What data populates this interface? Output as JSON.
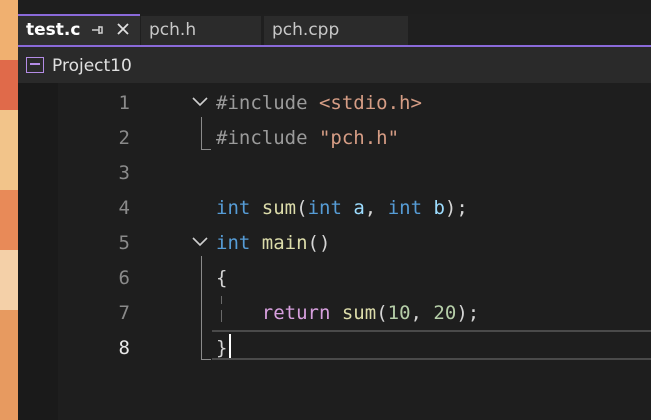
{
  "tabs": [
    {
      "label": "test.c",
      "active": true,
      "pin_icon": "pin-icon",
      "close_icon": "close-icon"
    },
    {
      "label": "pch.h",
      "active": false
    },
    {
      "label": "pch.cpp",
      "active": false
    }
  ],
  "navigation": {
    "project": "Project10",
    "project_icon": "project-icon"
  },
  "editor": {
    "line_numbers": [
      "1",
      "2",
      "3",
      "4",
      "5",
      "6",
      "7",
      "8"
    ],
    "current_line": "8",
    "lines": [
      [
        {
          "t": "#include ",
          "c": "pp"
        },
        {
          "t": "<stdio.h>",
          "c": "str"
        }
      ],
      [
        {
          "t": "#include ",
          "c": "pp"
        },
        {
          "t": "\"pch.h\"",
          "c": "str"
        }
      ],
      [],
      [
        {
          "t": "int",
          "c": "kw"
        },
        {
          "t": " ",
          "c": "punc"
        },
        {
          "t": "sum",
          "c": "fn"
        },
        {
          "t": "(",
          "c": "punc"
        },
        {
          "t": "int",
          "c": "kw"
        },
        {
          "t": " ",
          "c": "punc"
        },
        {
          "t": "a",
          "c": "id"
        },
        {
          "t": ", ",
          "c": "punc"
        },
        {
          "t": "int",
          "c": "kw"
        },
        {
          "t": " ",
          "c": "punc"
        },
        {
          "t": "b",
          "c": "id"
        },
        {
          "t": ");",
          "c": "punc"
        }
      ],
      [
        {
          "t": "int",
          "c": "kw"
        },
        {
          "t": " ",
          "c": "punc"
        },
        {
          "t": "main",
          "c": "fn"
        },
        {
          "t": "()",
          "c": "punc"
        }
      ],
      [
        {
          "t": "{",
          "c": "punc"
        }
      ],
      [
        {
          "t": "    ",
          "c": "punc"
        },
        {
          "t": "return",
          "c": "ctl"
        },
        {
          "t": " ",
          "c": "punc"
        },
        {
          "t": "sum",
          "c": "fn"
        },
        {
          "t": "(",
          "c": "punc"
        },
        {
          "t": "10",
          "c": "num"
        },
        {
          "t": ", ",
          "c": "punc"
        },
        {
          "t": "20",
          "c": "num"
        },
        {
          "t": ");",
          "c": "punc"
        }
      ],
      [
        {
          "t": "}",
          "c": "punc"
        }
      ]
    ]
  },
  "colors": {
    "accent": "#8a6ad9",
    "keyword": "#569cd6",
    "function": "#dcdcaa",
    "string": "#d69d85",
    "number": "#b5cea8",
    "control": "#d8a0df"
  }
}
